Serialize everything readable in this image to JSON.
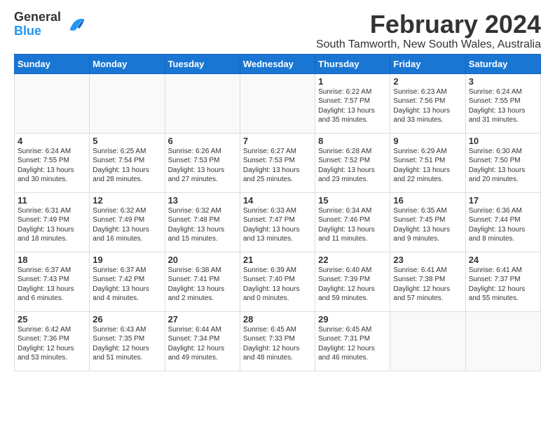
{
  "logo": {
    "general": "General",
    "blue": "Blue"
  },
  "title": "February 2024",
  "subtitle": "South Tamworth, New South Wales, Australia",
  "headers": [
    "Sunday",
    "Monday",
    "Tuesday",
    "Wednesday",
    "Thursday",
    "Friday",
    "Saturday"
  ],
  "weeks": [
    [
      {
        "day": "",
        "info": ""
      },
      {
        "day": "",
        "info": ""
      },
      {
        "day": "",
        "info": ""
      },
      {
        "day": "",
        "info": ""
      },
      {
        "day": "1",
        "info": "Sunrise: 6:22 AM\nSunset: 7:57 PM\nDaylight: 13 hours\nand 35 minutes."
      },
      {
        "day": "2",
        "info": "Sunrise: 6:23 AM\nSunset: 7:56 PM\nDaylight: 13 hours\nand 33 minutes."
      },
      {
        "day": "3",
        "info": "Sunrise: 6:24 AM\nSunset: 7:55 PM\nDaylight: 13 hours\nand 31 minutes."
      }
    ],
    [
      {
        "day": "4",
        "info": "Sunrise: 6:24 AM\nSunset: 7:55 PM\nDaylight: 13 hours\nand 30 minutes."
      },
      {
        "day": "5",
        "info": "Sunrise: 6:25 AM\nSunset: 7:54 PM\nDaylight: 13 hours\nand 28 minutes."
      },
      {
        "day": "6",
        "info": "Sunrise: 6:26 AM\nSunset: 7:53 PM\nDaylight: 13 hours\nand 27 minutes."
      },
      {
        "day": "7",
        "info": "Sunrise: 6:27 AM\nSunset: 7:53 PM\nDaylight: 13 hours\nand 25 minutes."
      },
      {
        "day": "8",
        "info": "Sunrise: 6:28 AM\nSunset: 7:52 PM\nDaylight: 13 hours\nand 23 minutes."
      },
      {
        "day": "9",
        "info": "Sunrise: 6:29 AM\nSunset: 7:51 PM\nDaylight: 13 hours\nand 22 minutes."
      },
      {
        "day": "10",
        "info": "Sunrise: 6:30 AM\nSunset: 7:50 PM\nDaylight: 13 hours\nand 20 minutes."
      }
    ],
    [
      {
        "day": "11",
        "info": "Sunrise: 6:31 AM\nSunset: 7:49 PM\nDaylight: 13 hours\nand 18 minutes."
      },
      {
        "day": "12",
        "info": "Sunrise: 6:32 AM\nSunset: 7:49 PM\nDaylight: 13 hours\nand 16 minutes."
      },
      {
        "day": "13",
        "info": "Sunrise: 6:32 AM\nSunset: 7:48 PM\nDaylight: 13 hours\nand 15 minutes."
      },
      {
        "day": "14",
        "info": "Sunrise: 6:33 AM\nSunset: 7:47 PM\nDaylight: 13 hours\nand 13 minutes."
      },
      {
        "day": "15",
        "info": "Sunrise: 6:34 AM\nSunset: 7:46 PM\nDaylight: 13 hours\nand 11 minutes."
      },
      {
        "day": "16",
        "info": "Sunrise: 6:35 AM\nSunset: 7:45 PM\nDaylight: 13 hours\nand 9 minutes."
      },
      {
        "day": "17",
        "info": "Sunrise: 6:36 AM\nSunset: 7:44 PM\nDaylight: 13 hours\nand 8 minutes."
      }
    ],
    [
      {
        "day": "18",
        "info": "Sunrise: 6:37 AM\nSunset: 7:43 PM\nDaylight: 13 hours\nand 6 minutes."
      },
      {
        "day": "19",
        "info": "Sunrise: 6:37 AM\nSunset: 7:42 PM\nDaylight: 13 hours\nand 4 minutes."
      },
      {
        "day": "20",
        "info": "Sunrise: 6:38 AM\nSunset: 7:41 PM\nDaylight: 13 hours\nand 2 minutes."
      },
      {
        "day": "21",
        "info": "Sunrise: 6:39 AM\nSunset: 7:40 PM\nDaylight: 13 hours\nand 0 minutes."
      },
      {
        "day": "22",
        "info": "Sunrise: 6:40 AM\nSunset: 7:39 PM\nDaylight: 12 hours\nand 59 minutes."
      },
      {
        "day": "23",
        "info": "Sunrise: 6:41 AM\nSunset: 7:38 PM\nDaylight: 12 hours\nand 57 minutes."
      },
      {
        "day": "24",
        "info": "Sunrise: 6:41 AM\nSunset: 7:37 PM\nDaylight: 12 hours\nand 55 minutes."
      }
    ],
    [
      {
        "day": "25",
        "info": "Sunrise: 6:42 AM\nSunset: 7:36 PM\nDaylight: 12 hours\nand 53 minutes."
      },
      {
        "day": "26",
        "info": "Sunrise: 6:43 AM\nSunset: 7:35 PM\nDaylight: 12 hours\nand 51 minutes."
      },
      {
        "day": "27",
        "info": "Sunrise: 6:44 AM\nSunset: 7:34 PM\nDaylight: 12 hours\nand 49 minutes."
      },
      {
        "day": "28",
        "info": "Sunrise: 6:45 AM\nSunset: 7:33 PM\nDaylight: 12 hours\nand 48 minutes."
      },
      {
        "day": "29",
        "info": "Sunrise: 6:45 AM\nSunset: 7:31 PM\nDaylight: 12 hours\nand 46 minutes."
      },
      {
        "day": "",
        "info": ""
      },
      {
        "day": "",
        "info": ""
      }
    ]
  ]
}
